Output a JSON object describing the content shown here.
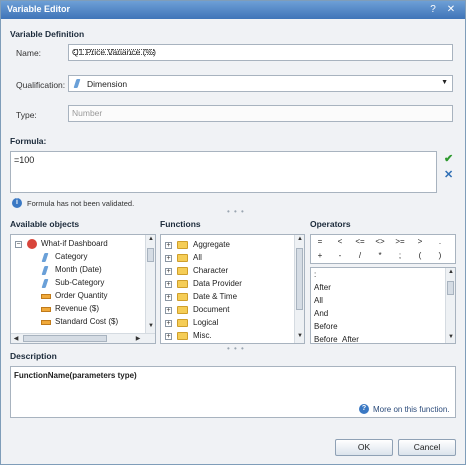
{
  "window": {
    "title": "Variable Editor",
    "help_icon": "help-icon",
    "close_icon": "close-icon"
  },
  "definition": {
    "section_title": "Variable Definition",
    "name_label": "Name:",
    "name_value": "Q1 Price Variance (%)",
    "qualification_label": "Qualification:",
    "qualification_value": "Dimension",
    "type_label": "Type:",
    "type_placeholder": "Number"
  },
  "formula": {
    "section_title": "Formula:",
    "value": "=100",
    "status": "Formula has not been validated."
  },
  "objects": {
    "section_title": "Available objects",
    "items": [
      {
        "label": "What-if Dashboard",
        "kind": "root"
      },
      {
        "label": "Category",
        "kind": "dimension"
      },
      {
        "label": "Month (Date)",
        "kind": "dimension"
      },
      {
        "label": "Sub-Category",
        "kind": "dimension"
      },
      {
        "label": "Order Quantity",
        "kind": "measure"
      },
      {
        "label": "Revenue ($)",
        "kind": "measure"
      },
      {
        "label": "Standard Cost ($)",
        "kind": "measure"
      }
    ]
  },
  "functions": {
    "section_title": "Functions",
    "items": [
      "Aggregate",
      "All",
      "Character",
      "Data Provider",
      "Date & Time",
      "Document",
      "Logical",
      "Misc."
    ]
  },
  "operators": {
    "section_title": "Operators",
    "row1": [
      "=",
      "<",
      "<=",
      "<>",
      ">=",
      ">",
      "."
    ],
    "row2": [
      "+",
      "-",
      "/",
      "*",
      ";",
      "(",
      ")"
    ],
    "list": [
      ":",
      "After",
      "All",
      "And",
      "Before",
      "Before_After"
    ]
  },
  "description": {
    "section_title": "Description",
    "text": "FunctionName(parameters type)",
    "more_link": "More on this function."
  },
  "buttons": {
    "ok": "OK",
    "cancel": "Cancel"
  }
}
